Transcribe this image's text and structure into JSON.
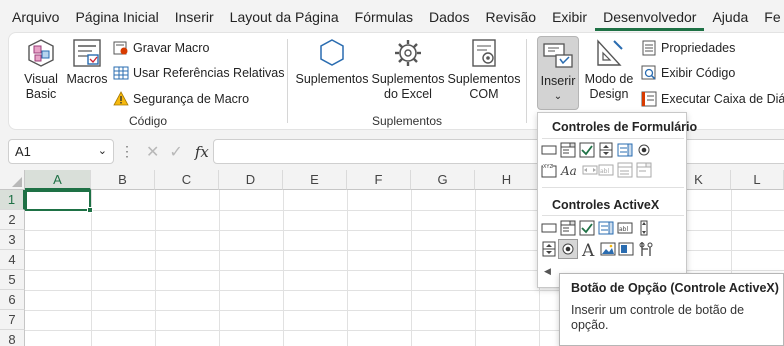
{
  "menu": {
    "tabs": [
      "Arquivo",
      "Página Inicial",
      "Inserir",
      "Layout da Página",
      "Fórmulas",
      "Dados",
      "Revisão",
      "Exibir",
      "Desenvolvedor",
      "Ajuda",
      "Fe"
    ],
    "active_tab": "Desenvolvedor"
  },
  "ribbon": {
    "codigo": {
      "label": "Código",
      "visual_basic": "Visual Basic",
      "visual_basic_line1": "Visual",
      "visual_basic_line2": "Basic",
      "macros": "Macros",
      "gravar_macro": "Gravar Macro",
      "referencias": "Usar Referências Relativas",
      "seguranca": "Segurança de Macro"
    },
    "suplementos": {
      "label": "Suplementos",
      "suplementos": "Suplementos",
      "excel_line1": "Suplementos",
      "excel_line2": "do Excel",
      "com_line1": "Suplementos",
      "com_line2": "COM"
    },
    "controles": {
      "inserir": "Inserir",
      "modo_line1": "Modo de",
      "modo_line2": "Design",
      "propriedades": "Propriedades",
      "exibir_codigo": "Exibir Código",
      "executar": "Executar Caixa de Diálogo",
      "label_partial": "es"
    }
  },
  "formula_bar": {
    "name_box": "A1",
    "fx": "fx",
    "cancel": "✕",
    "enter": "✓",
    "value": ""
  },
  "grid": {
    "columns": [
      "A",
      "B",
      "C",
      "D",
      "E",
      "F",
      "G",
      "H",
      "I",
      "J",
      "K",
      "L"
    ],
    "rows": [
      "1",
      "2",
      "3",
      "4",
      "5",
      "6",
      "7",
      "8"
    ],
    "active_cell": "A1"
  },
  "insert_panel": {
    "form_controls_title": "Controles de Formulário",
    "activex_controls_title": "Controles ActiveX",
    "xyz_label": "XYZ",
    "aa_label": "Aa",
    "abl_label": "abl",
    "a_label": "A"
  },
  "tooltip": {
    "title": "Botão de Opção (Controle ActiveX)",
    "body": "Inserir um controle de botão de opção."
  },
  "colors": {
    "accent": "#1e7145",
    "ribbon_bg": "#ffffff",
    "app_bg": "#f3f3f3"
  }
}
